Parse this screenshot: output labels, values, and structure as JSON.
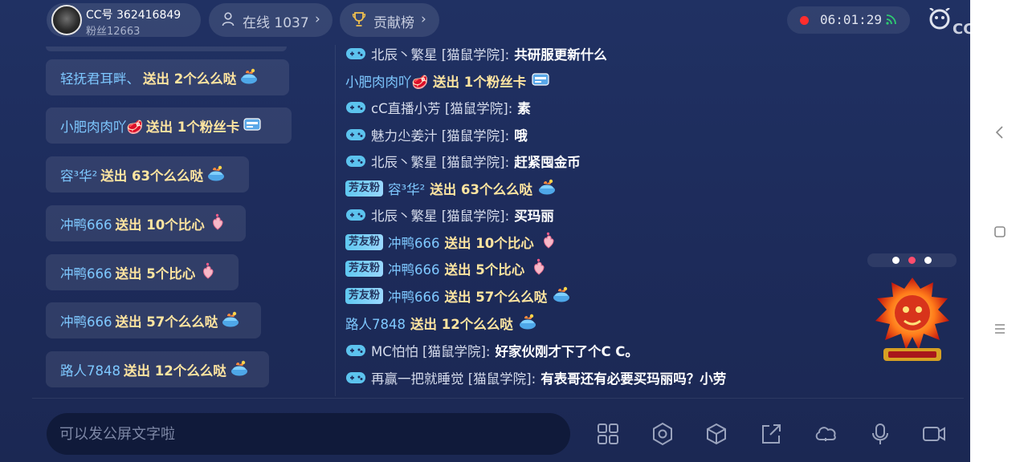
{
  "header": {
    "cc_id": "CC号 362416849",
    "fans": "粉丝12663",
    "online": "在线 1037",
    "rank": "贡献榜",
    "chevron": "›",
    "timer": "06:01:29",
    "logo_text": "CC直播",
    "rec_color": "#ff2d2d",
    "signal_color": "#2ecc71"
  },
  "gifts": [
    {
      "user": "轻抚君耳畔、",
      "text": "送出 2个么么哒",
      "gift_icon": "kiss-gift-icon"
    },
    {
      "user": "小肥肉肉吖🥩",
      "text": "送出 1个粉丝卡",
      "gift_icon": "fan-card-icon"
    },
    {
      "user": "容³华²",
      "text": "送出 63个么么哒",
      "gift_icon": "kiss-gift-icon"
    },
    {
      "user": "冲鸭666",
      "text": "送出 10个比心",
      "gift_icon": "heart-hand-icon"
    },
    {
      "user": "冲鸭666",
      "text": "送出 5个比心",
      "gift_icon": "heart-hand-icon"
    },
    {
      "user": "冲鸭666",
      "text": "送出 57个么么哒",
      "gift_icon": "kiss-gift-icon"
    },
    {
      "user": "路人7848",
      "text": "送出 12个么么哒",
      "gift_icon": "kiss-gift-icon"
    }
  ],
  "chat": [
    {
      "type": "msg",
      "name": "北辰丶繁星 [猫鼠学院]:",
      "text": "共研服更新什么"
    },
    {
      "type": "gift",
      "badge": "",
      "user": "小肥肉肉吖🥩",
      "text": "送出 1个粉丝卡",
      "gift_icon": "fan-card-icon"
    },
    {
      "type": "msg",
      "name": "cC直播小芳 [猫鼠学院]:",
      "text": "素"
    },
    {
      "type": "msg",
      "name": "魅力尐姜汁 [猫鼠学院]:",
      "text": "哦"
    },
    {
      "type": "msg",
      "name": "北辰丶繁星 [猫鼠学院]:",
      "text": "赶紧囤金币"
    },
    {
      "type": "gift",
      "badge": "芳友粉",
      "user": "容³华²",
      "text": "送出 63个么么哒",
      "gift_icon": "kiss-gift-icon"
    },
    {
      "type": "msg",
      "name": "北辰丶繁星 [猫鼠学院]:",
      "text": "买玛丽"
    },
    {
      "type": "gift",
      "badge": "芳友粉",
      "user": "冲鸭666",
      "text": "送出 10个比心",
      "gift_icon": "heart-hand-icon"
    },
    {
      "type": "gift",
      "badge": "芳友粉",
      "user": "冲鸭666",
      "text": "送出 5个比心",
      "gift_icon": "heart-hand-icon"
    },
    {
      "type": "gift",
      "badge": "芳友粉",
      "user": "冲鸭666",
      "text": "送出 57个么么哒",
      "gift_icon": "kiss-gift-icon"
    },
    {
      "type": "gift",
      "badge": "",
      "user": "路人7848",
      "text": "送出 12个么么哒",
      "gift_icon": "kiss-gift-icon"
    },
    {
      "type": "msg",
      "name": "MC怕怕 [猫鼠学院]:",
      "text": "好家伙刚才下了个C C。"
    },
    {
      "type": "msg",
      "name": "再赢一把就睡觉 [猫鼠学院]:",
      "text": "有表哥还有必要买玛丽吗？小劳"
    }
  ],
  "input": {
    "placeholder": "可以发公屏文字啦"
  },
  "toolbar": [
    "grid-icon",
    "settings-icon",
    "cube-icon",
    "share-icon",
    "cloud-heart-icon",
    "microphone-icon",
    "video-icon"
  ],
  "banner_dots": {
    "active_color": "#ff4d6d",
    "inactive_color": "#ffffff"
  }
}
